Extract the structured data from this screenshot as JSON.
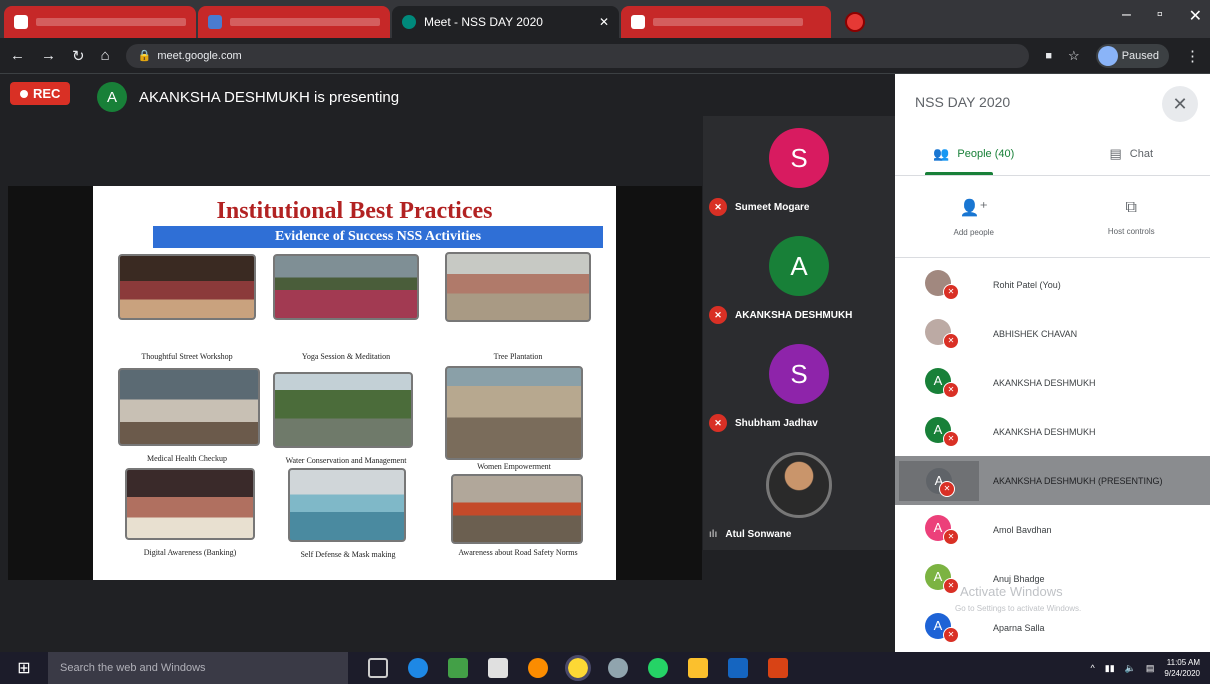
{
  "browser": {
    "active_tab_title": "Meet - NSS DAY 2020",
    "url_host": "meet.google.com",
    "profile_label": "Paused"
  },
  "meet": {
    "rec_label": "REC",
    "presenter_initial": "A",
    "presenter_text": "AKANKSHA DESHMUKH is presenting"
  },
  "slide": {
    "title": "Institutional Best Practices",
    "subtitle": "Evidence of Success NSS Activities",
    "captions": [
      "Thoughtful Street Workshop",
      "Yoga Session & Meditation",
      "Tree Plantation",
      "Medical Health Checkup",
      "Water Conservation and Management",
      "Women Empowerment",
      "Digital Awareness (Banking)",
      "Self Defense & Mask making",
      "Awareness about Road Safety Norms"
    ]
  },
  "strip": {
    "tiles": [
      {
        "initial": "S",
        "name": "Sumeet Mogare",
        "color": "#d81b60"
      },
      {
        "initial": "A",
        "name": "AKANKSHA DESHMUKH",
        "color": "#188038"
      },
      {
        "initial": "S",
        "name": "Shubham Jadhav",
        "color": "#8e24aa"
      },
      {
        "initial": "",
        "name": "Atul Sonwane",
        "color": "#3c4043"
      }
    ]
  },
  "panel": {
    "title": "NSS DAY 2020",
    "tab_people": "People (40)",
    "tab_chat": "Chat",
    "action_add": "Add people",
    "action_host": "Host controls",
    "participants": [
      {
        "initial": "",
        "name": "Rohit Patel (You)",
        "color": "#a1887f",
        "highlight": false
      },
      {
        "initial": "",
        "name": "ABHISHEK CHAVAN",
        "color": "#bcaaa4",
        "highlight": false
      },
      {
        "initial": "A",
        "name": "AKANKSHA DESHMUKH",
        "color": "#188038",
        "highlight": false
      },
      {
        "initial": "A",
        "name": "AKANKSHA DESHMUKH",
        "color": "#188038",
        "highlight": false
      },
      {
        "initial": "A",
        "name": "AKANKSHA DESHMUKH (PRESENTING)",
        "color": "#5f6368",
        "highlight": true
      },
      {
        "initial": "A",
        "name": "Amol Bavdhan",
        "color": "#ec407a",
        "highlight": false
      },
      {
        "initial": "A",
        "name": "Anuj Bhadge",
        "color": "#7cb342",
        "highlight": false
      },
      {
        "initial": "A",
        "name": "Aparna Salla",
        "color": "#1e63d6",
        "highlight": false
      }
    ],
    "watermark_1": "Activate Windows",
    "watermark_2": "Go to Settings to activate Windows."
  },
  "taskbar": {
    "search_placeholder": "Search the web and Windows",
    "time": "11:05 AM",
    "date": "9/24/2020"
  }
}
